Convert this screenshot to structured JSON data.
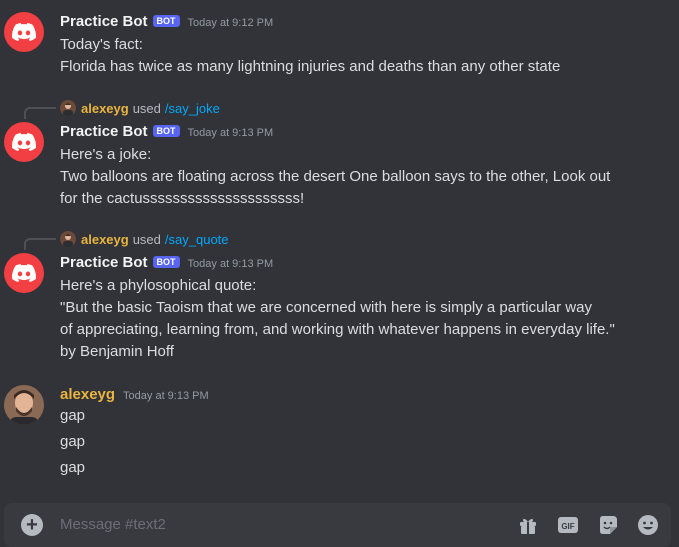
{
  "messages": [
    {
      "author": "Practice Bot",
      "badge": "BOT",
      "timestamp": "Today at 9:12 PM",
      "lines": [
        "Today's fact:",
        "Florida has twice as many lightning injuries and deaths than any other state"
      ]
    },
    {
      "reply": {
        "user": "alexeyg",
        "verb": "used",
        "command": "/say_joke"
      },
      "author": "Practice Bot",
      "badge": "BOT",
      "timestamp": "Today at 9:13 PM",
      "lines": [
        "Here's a joke:",
        "Two balloons are floating across the desert One balloon says to the other, Look out",
        "for the cactusssssssssssssssssssss!"
      ]
    },
    {
      "reply": {
        "user": "alexeyg",
        "verb": "used",
        "command": "/say_quote"
      },
      "author": "Practice Bot",
      "badge": "BOT",
      "timestamp": "Today at 9:13 PM",
      "lines": [
        "Here's a phylosophical quote:",
        "\"But the basic Taoism that we are concerned with here is simply a particular way",
        "of appreciating, learning from, and working with whatever happens in everyday life.\"",
        "by Benjamin Hoff"
      ]
    },
    {
      "author": "alexeyg",
      "timestamp": "Today at 9:13 PM",
      "lines": [
        "gap",
        "gap",
        "gap"
      ]
    }
  ],
  "composer": {
    "placeholder": "Message #text2"
  },
  "icons": {
    "bot_avatar": "discord-logo-icon",
    "user_avatar": "user-photo-avatar",
    "gift": "gift-icon",
    "gif": "gif-icon",
    "sticker": "sticker-icon",
    "emoji": "emoji-icon"
  },
  "colors": {
    "background": "#313338",
    "bot_avatar": "#f23f43",
    "bot_badge": "#5865f2",
    "user_name": "#e9b53f",
    "command_link": "#00a8fc"
  }
}
